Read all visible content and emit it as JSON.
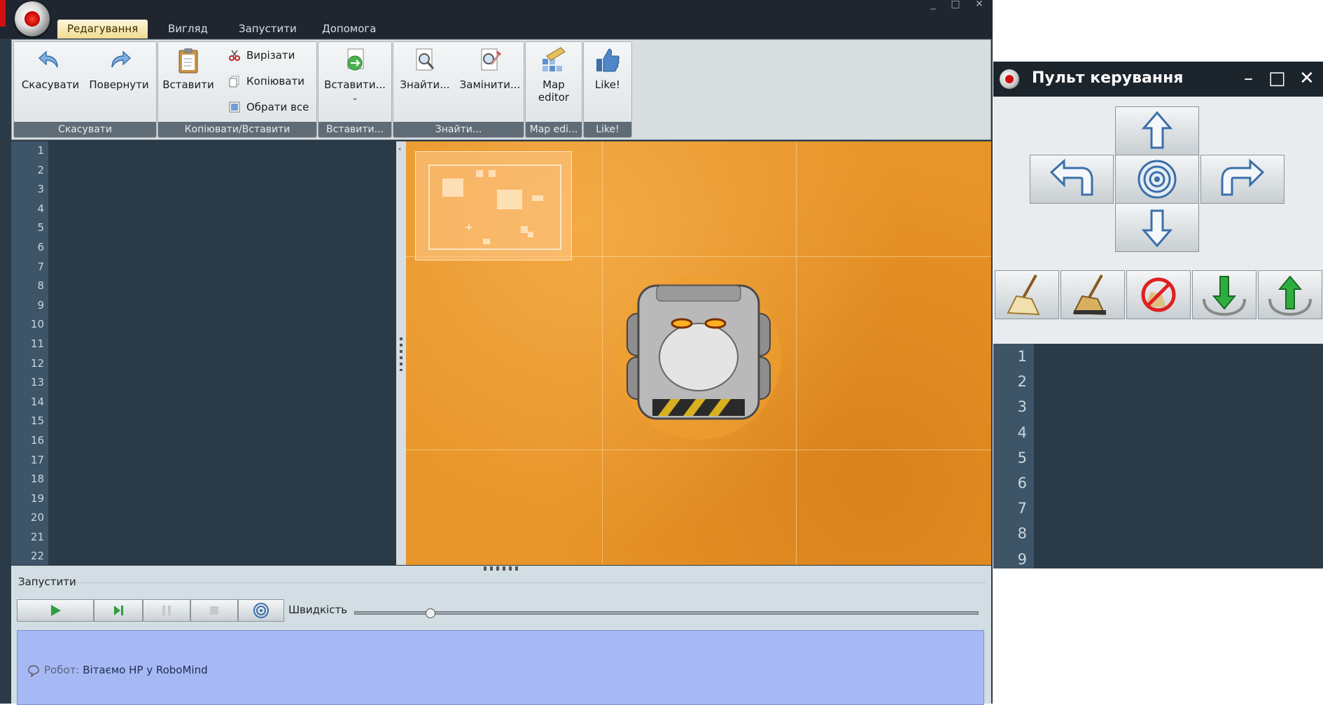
{
  "menu": {
    "tabs": [
      "Редагування",
      "Вигляд",
      "Запустити",
      "Допомога"
    ]
  },
  "ribbon": {
    "undo_group": {
      "undo": "Скасувати",
      "redo": "Повернути",
      "label": "Скасувати"
    },
    "clipboard_group": {
      "paste": "Вставити",
      "cut": "Вирізати",
      "copy": "Копіювати",
      "select_all": "Обрати все",
      "label": "Копіювати/Вставити"
    },
    "insert_group": {
      "insert": "Вставити...",
      "label": "Вставити..."
    },
    "find_group": {
      "find": "Знайти...",
      "replace": "Замінити...",
      "label": "Знайти..."
    },
    "map_group": {
      "map_line1": "Map",
      "map_line2": "editor",
      "label": "Map edi..."
    },
    "like_group": {
      "like": "Like!",
      "label": "Like!"
    }
  },
  "editor": {
    "line_numbers": [
      "1",
      "2",
      "3",
      "4",
      "5",
      "6",
      "7",
      "8",
      "9",
      "10",
      "11",
      "12",
      "13",
      "14",
      "15",
      "16",
      "17",
      "18",
      "19",
      "20",
      "21",
      "22"
    ]
  },
  "run_panel": {
    "title": "Запустити",
    "speed_label": "Швидкість",
    "speed_value": 0.12
  },
  "console": {
    "prefix": "Робот:",
    "message": "Вітаємо HP у RoboMind"
  },
  "control_panel": {
    "title": "Пульт керування",
    "line_numbers": [
      "1",
      "2",
      "3",
      "4",
      "5",
      "6",
      "7",
      "8",
      "9"
    ]
  },
  "colors": {
    "map_ground": "#e8952a",
    "console_bg": "#a7b9f5",
    "editor_bg": "#2b3a47",
    "gutter_bg": "#3e5568"
  }
}
